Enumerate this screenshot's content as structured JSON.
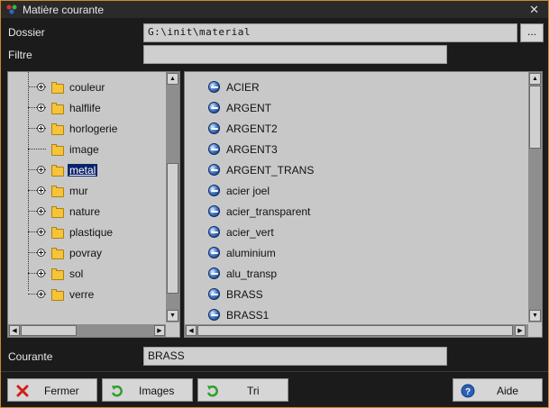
{
  "window": {
    "title": "Matière courante",
    "close_glyph": "✕"
  },
  "dossier": {
    "label": "Dossier",
    "value": "G:\\init\\material",
    "browse_label": "..."
  },
  "filtre": {
    "label": "Filtre",
    "value": ""
  },
  "tree": {
    "items": [
      {
        "label": "couleur",
        "expandable": true
      },
      {
        "label": "halflife",
        "expandable": true
      },
      {
        "label": "horlogerie",
        "expandable": true
      },
      {
        "label": "image",
        "expandable": false
      },
      {
        "label": "metal",
        "expandable": true,
        "selected": true
      },
      {
        "label": "mur",
        "expandable": true
      },
      {
        "label": "nature",
        "expandable": true
      },
      {
        "label": "plastique",
        "expandable": true
      },
      {
        "label": "povray",
        "expandable": true
      },
      {
        "label": "sol",
        "expandable": true
      },
      {
        "label": "verre",
        "expandable": true
      }
    ]
  },
  "materials": {
    "items": [
      "ACIER",
      "ARGENT",
      "ARGENT2",
      "ARGENT3",
      "ARGENT_TRANS",
      "acier joel",
      "acier_transparent",
      "acier_vert",
      "aluminium",
      "alu_transp",
      "BRASS",
      "BRASS1"
    ]
  },
  "courante": {
    "label": "Courante",
    "value": "BRASS"
  },
  "buttons": {
    "fermer": "Fermer",
    "images": "Images",
    "tri": "Tri",
    "aide": "Aide"
  },
  "scroll": {
    "arrow_up": "▲",
    "arrow_down": "▼",
    "arrow_left": "◀",
    "arrow_right": "▶"
  },
  "colors": {
    "accent_border": "#c88a2a",
    "selection": "#0a246a",
    "folder": "#f5c43a"
  }
}
